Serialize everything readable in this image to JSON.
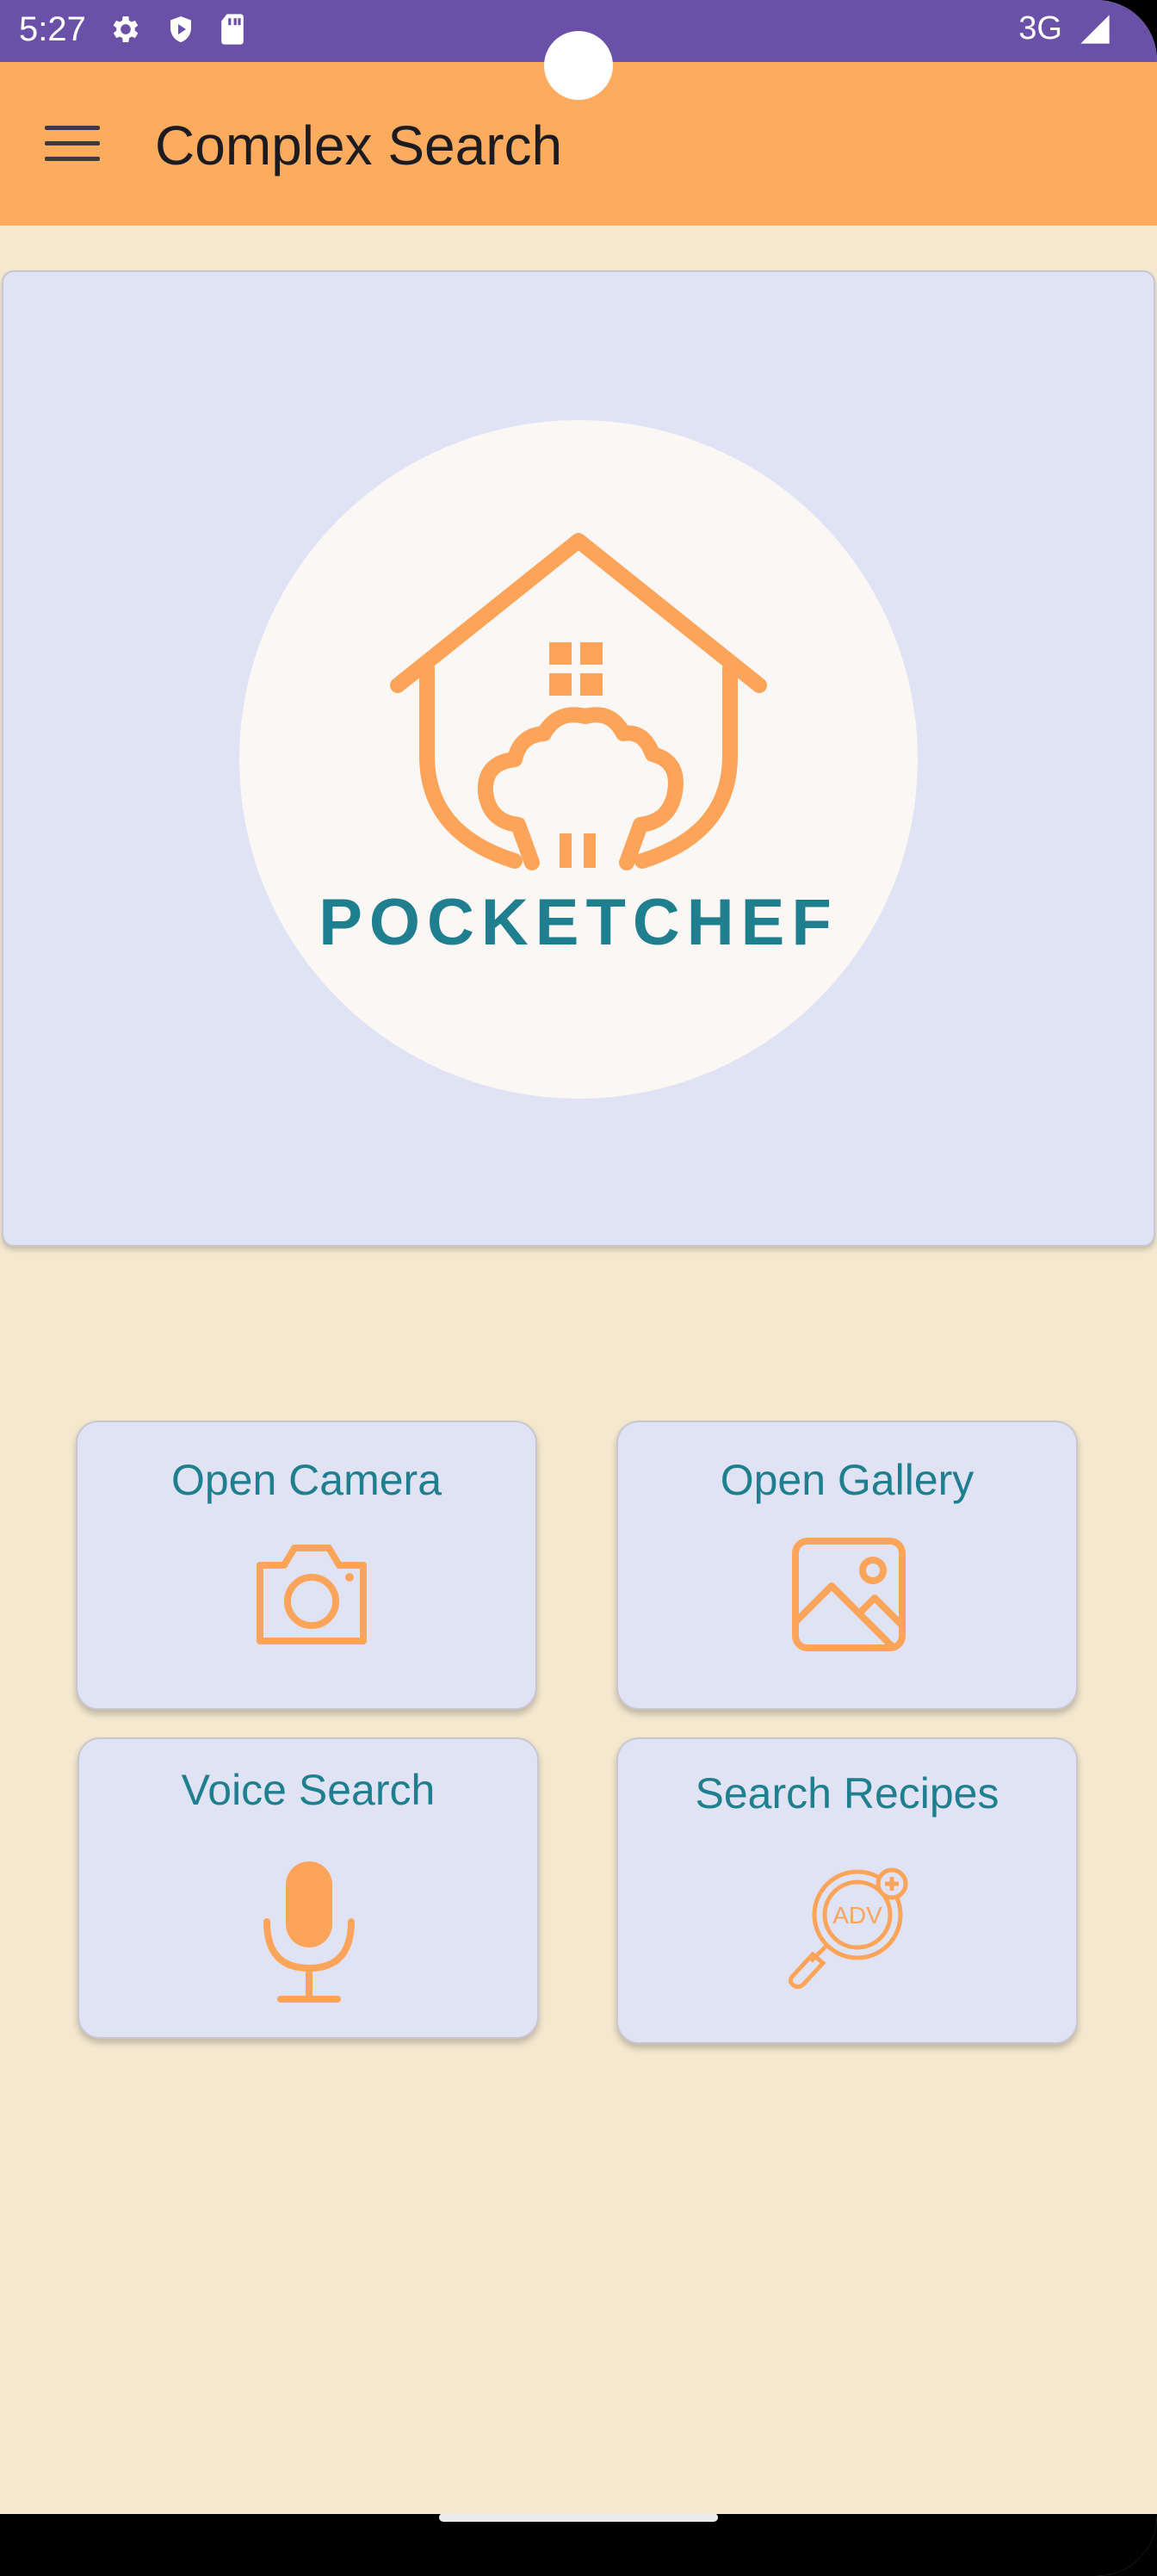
{
  "status_bar": {
    "time": "5:27",
    "network": "3G",
    "icons": [
      "settings-icon",
      "shield-icon",
      "sd-card-icon",
      "signal-icon"
    ]
  },
  "app_bar": {
    "title": "Complex Search",
    "menu_icon": "menu-icon"
  },
  "hero": {
    "brand_name": "POCKETCHEF",
    "logo_icon": "house-chef-hat-logo"
  },
  "actions": [
    {
      "label": "Open Camera",
      "icon": "camera-icon"
    },
    {
      "label": "Open Gallery",
      "icon": "image-icon"
    },
    {
      "label": "Voice Search",
      "icon": "microphone-icon"
    },
    {
      "label": "Search Recipes",
      "icon": "advanced-search-icon"
    }
  ],
  "colors": {
    "status_bar": "#6a50a7",
    "app_bar": "#fdac5f",
    "background": "#f4e8cf",
    "card": "#e0e3f4",
    "accent_text": "#1f7f8f",
    "icon_orange": "#fba45a"
  }
}
